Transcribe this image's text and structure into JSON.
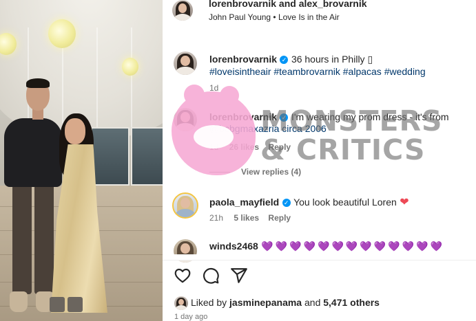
{
  "header": {
    "usernames": "lorenbrovarnik and alex_brovarnik",
    "audio": "John Paul Young • Love Is in the Air"
  },
  "caption": {
    "username": "lorenbrovarnik",
    "text": "36 hours in Philly ▯",
    "hashtags": "#loveisintheair #teambrovarnik #alpacas #wedding",
    "time": "1d"
  },
  "comments": [
    {
      "username": "lorenbrovarnik",
      "text": "I'm wearing my prom dress - it's from",
      "mention": "@bcbgmaxazria circa 2006",
      "time": "1d",
      "likes": "26 likes",
      "reply": "Reply",
      "view_replies": "View replies (4)"
    },
    {
      "username": "paola_mayfield",
      "text": "You look beautiful Loren",
      "time": "21h",
      "likes": "5 likes",
      "reply": "Reply"
    },
    {
      "username": "winds2468",
      "text": "💜💜💜💜💜💜💜💜💜💜💜💜💜"
    }
  ],
  "likes": {
    "prefix": "Liked by ",
    "user": "jasminepanama",
    "middle": " and ",
    "count": "5,471 others"
  },
  "post_time": "1 day ago",
  "watermark": {
    "line1": "MONSTERS",
    "line2": "& CRITICS"
  },
  "colors": {
    "verified": "#0095f6",
    "link": "#00376b",
    "secondary_text": "#737373",
    "watermark_pink": "#f7a9d4"
  },
  "icons": {
    "like": "heart-outline-icon",
    "comment": "comment-bubble-icon",
    "share": "paper-plane-icon",
    "verified": "verified-badge-icon"
  }
}
